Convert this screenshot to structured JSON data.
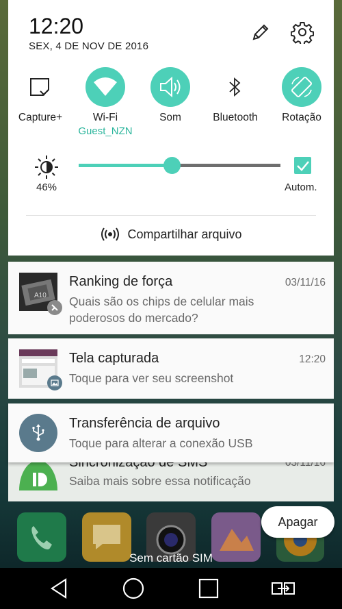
{
  "status": {
    "time": "12:20",
    "date": "SEX, 4 DE NOV DE 2016",
    "edit_icon": "pencil-icon",
    "settings_icon": "gear-icon"
  },
  "quick_settings": {
    "tiles": [
      {
        "label": "Capture+",
        "sub": "",
        "icon": "capture-plus-icon",
        "active": false
      },
      {
        "label": "Wi-Fi",
        "sub": "Guest_NZN",
        "icon": "wifi-icon",
        "active": true
      },
      {
        "label": "Som",
        "sub": "",
        "icon": "speaker-icon",
        "active": true
      },
      {
        "label": "Bluetooth",
        "sub": "",
        "icon": "bluetooth-icon",
        "active": false
      },
      {
        "label": "Rotação",
        "sub": "",
        "icon": "rotation-icon",
        "active": true
      }
    ],
    "brightness": {
      "percent_label": "46%",
      "level": 0.46,
      "auto_label": "Autom.",
      "auto_checked": true
    },
    "share_label": "Compartilhar arquivo"
  },
  "notifications": [
    {
      "title": "Ranking de força",
      "time": "03/11/16",
      "text": "Quais são os chips de celular mais poderosos do mercado?"
    },
    {
      "title": "Tela capturada",
      "time": "12:20",
      "text": "Toque para ver seu screenshot"
    },
    {
      "title": "Transferência de arquivo",
      "time": "",
      "text": "Toque para alterar a conexão USB"
    },
    {
      "title": "Sincronização de SMS",
      "time": "03/11/16",
      "text": "Saiba mais sobre essa notificação"
    }
  ],
  "clear_button": "Apagar",
  "no_sim": "Sem cartão SIM",
  "colors": {
    "accent": "#4dd0b8",
    "usb_circle": "#5a7a8c",
    "pushbullet": "#4cb050"
  }
}
